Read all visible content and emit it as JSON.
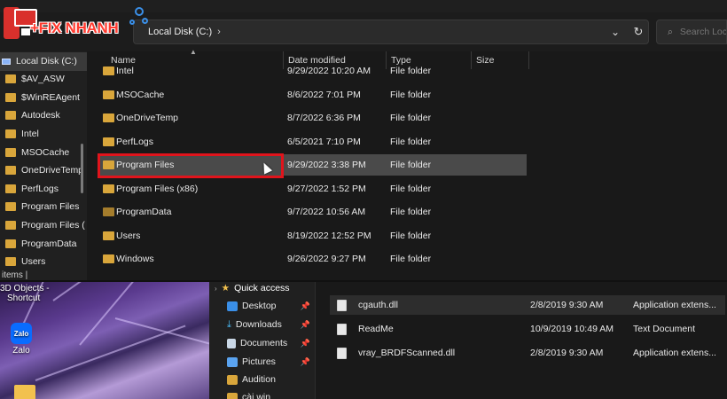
{
  "logo": {
    "text": "+FIX NHANH"
  },
  "address": {
    "path": "Local Disk (C:)",
    "separator": "›"
  },
  "search": {
    "placeholder": "Search Loc"
  },
  "columns": {
    "name": "Name",
    "date": "Date modified",
    "type": "Type",
    "size": "Size"
  },
  "nav": {
    "drive": "Local Disk (C:)",
    "items": [
      "$AV_ASW",
      "$WinREAgent",
      "Autodesk",
      "Intel",
      "MSOCache",
      "OneDriveTemp",
      "PerfLogs",
      "Program Files",
      "Program Files (",
      "ProgramData",
      "Users"
    ]
  },
  "status": {
    "text": "items  |"
  },
  "files": [
    {
      "name": "Intel",
      "date": "9/29/2022 10:20 AM",
      "type": "File folder"
    },
    {
      "name": "MSOCache",
      "date": "8/6/2022 7:01 PM",
      "type": "File folder"
    },
    {
      "name": "OneDriveTemp",
      "date": "8/7/2022 6:36 PM",
      "type": "File folder"
    },
    {
      "name": "PerfLogs",
      "date": "6/5/2021 7:10 PM",
      "type": "File folder"
    },
    {
      "name": "Program Files",
      "date": "9/29/2022 3:38 PM",
      "type": "File folder"
    },
    {
      "name": "Program Files (x86)",
      "date": "9/27/2022 1:52 PM",
      "type": "File folder"
    },
    {
      "name": "ProgramData",
      "date": "9/7/2022 10:56 AM",
      "type": "File folder"
    },
    {
      "name": "Users",
      "date": "8/19/2022 12:52 PM",
      "type": "File folder"
    },
    {
      "name": "Windows",
      "date": "9/26/2022 9:27 PM",
      "type": "File folder"
    }
  ],
  "desktop": {
    "shortcut_top": "3D Objects -",
    "shortcut_bottom": "Shortcut",
    "zalo_label": "Zalo",
    "zalo_icon": "Zalo"
  },
  "back_nav": {
    "quick_access": "Quick access",
    "items": [
      "Desktop",
      "Downloads",
      "Documents",
      "Pictures",
      "Audition",
      "cài win"
    ]
  },
  "back_files": [
    {
      "name": "cgauth.dll",
      "date": "2/8/2019 9:30 AM",
      "type": "Application extens..."
    },
    {
      "name": "ReadMe",
      "date": "10/9/2019 10:49 AM",
      "type": "Text Document"
    },
    {
      "name": "vray_BRDFScanned.dll",
      "date": "2/8/2019 9:30 AM",
      "type": "Application extens..."
    }
  ],
  "colors": {
    "highlight": "#e0141c",
    "folder": "#d9a63b",
    "background": "#191919"
  },
  "icons": {
    "folder": "folder-icon",
    "drive": "drive-icon",
    "refresh": "refresh-icon",
    "search": "search-icon",
    "chevron": "chevron-down-icon",
    "pin": "pin-icon"
  }
}
